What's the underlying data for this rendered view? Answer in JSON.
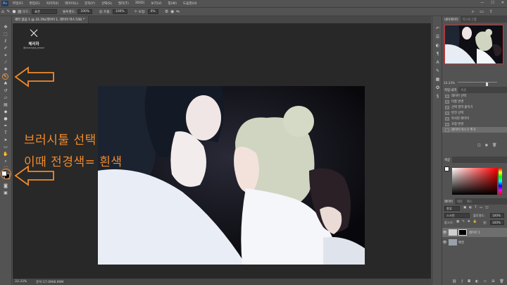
{
  "app": {
    "logo": "Ps",
    "menu": [
      "파일(F)",
      "편집(E)",
      "이미지(I)",
      "레이어(L)",
      "문자(Y)",
      "선택(S)",
      "필터(T)",
      "3D(D)",
      "보기(V)",
      "창(W)",
      "도움말(H)"
    ],
    "window_controls": [
      "—",
      "☐",
      "✕"
    ]
  },
  "options_bar": {
    "mode_label": "모드:",
    "mode_value": "표준",
    "opacity_label": "불투명도:",
    "opacity_value": "100%",
    "flow_label": "흐름:",
    "flow_value": "100%",
    "smoothing_label": "보정:",
    "smoothing_value": "0%"
  },
  "document": {
    "tab_title": "제목 없음-1 @ 33.3%(레이어 1, 레이어 마스크/8) *",
    "status_zoom": "33.33%",
    "status_doc": "문서:17.0M/8.99M"
  },
  "watermark": {
    "title": "체리하",
    "subtitle": "@cherryha_miner"
  },
  "annotation": {
    "line1": "브러시툴 선택",
    "line2": "이때 전경색= 흰색",
    "color": "#f08a2a"
  },
  "navigator": {
    "tabs": [
      "내비게이터",
      "히스토그램"
    ],
    "zoom": "33.33%"
  },
  "history": {
    "tabs": [
      "작업 내역",
      "속성"
    ],
    "items": [
      "레이어 선택",
      "이름 변경",
      "선택 영역 붙이기",
      "반전 선택",
      "복사된 레이어",
      "조합 변경",
      "레이어 마스크 추가"
    ]
  },
  "color": {
    "tabs": [
      "색상"
    ]
  },
  "layers": {
    "tabs": [
      "레이어",
      "채널",
      "패스"
    ],
    "kind": "종류",
    "blend": "스크린",
    "opacity_label": "불투명도:",
    "opacity_value": "100%",
    "lock_label": "잠그기:",
    "fill_label": "칠:",
    "fill_value": "100%",
    "rows": [
      {
        "name": "레이어 1"
      },
      {
        "name": "배경"
      }
    ]
  }
}
